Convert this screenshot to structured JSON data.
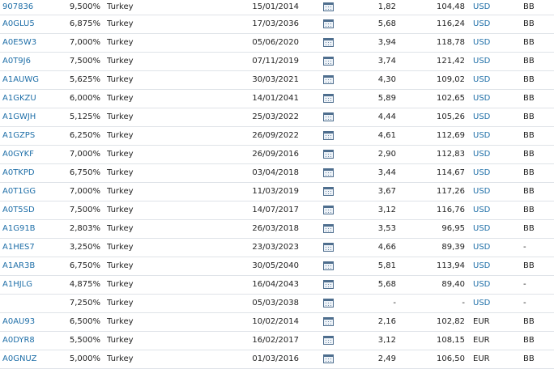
{
  "colors": {
    "link": "#1f6fa8",
    "row_border": "#dfe3e8",
    "text": "#222222"
  },
  "row_icon": "calendar-icon",
  "bonds": [
    {
      "wkn": "907836",
      "coupon": "9,500%",
      "issuer": "Turkey",
      "maturity": "15/01/2014",
      "duration": "1,82",
      "price": "104,48",
      "currency": "USD",
      "rating": "BB"
    },
    {
      "wkn": "A0GLU5",
      "coupon": "6,875%",
      "issuer": "Turkey",
      "maturity": "17/03/2036",
      "duration": "5,68",
      "price": "116,24",
      "currency": "USD",
      "rating": "BB"
    },
    {
      "wkn": "A0E5W3",
      "coupon": "7,000%",
      "issuer": "Turkey",
      "maturity": "05/06/2020",
      "duration": "3,94",
      "price": "118,78",
      "currency": "USD",
      "rating": "BB"
    },
    {
      "wkn": "A0T9J6",
      "coupon": "7,500%",
      "issuer": "Turkey",
      "maturity": "07/11/2019",
      "duration": "3,74",
      "price": "121,42",
      "currency": "USD",
      "rating": "BB"
    },
    {
      "wkn": "A1AUWG",
      "coupon": "5,625%",
      "issuer": "Turkey",
      "maturity": "30/03/2021",
      "duration": "4,30",
      "price": "109,02",
      "currency": "USD",
      "rating": "BB"
    },
    {
      "wkn": "A1GKZU",
      "coupon": "6,000%",
      "issuer": "Turkey",
      "maturity": "14/01/2041",
      "duration": "5,89",
      "price": "102,65",
      "currency": "USD",
      "rating": "BB"
    },
    {
      "wkn": "A1GWJH",
      "coupon": "5,125%",
      "issuer": "Turkey",
      "maturity": "25/03/2022",
      "duration": "4,44",
      "price": "105,26",
      "currency": "USD",
      "rating": "BB"
    },
    {
      "wkn": "A1GZPS",
      "coupon": "6,250%",
      "issuer": "Turkey",
      "maturity": "26/09/2022",
      "duration": "4,61",
      "price": "112,69",
      "currency": "USD",
      "rating": "BB"
    },
    {
      "wkn": "A0GYKF",
      "coupon": "7,000%",
      "issuer": "Turkey",
      "maturity": "26/09/2016",
      "duration": "2,90",
      "price": "112,83",
      "currency": "USD",
      "rating": "BB"
    },
    {
      "wkn": "A0TKPD",
      "coupon": "6,750%",
      "issuer": "Turkey",
      "maturity": "03/04/2018",
      "duration": "3,44",
      "price": "114,67",
      "currency": "USD",
      "rating": "BB"
    },
    {
      "wkn": "A0T1GG",
      "coupon": "7,000%",
      "issuer": "Turkey",
      "maturity": "11/03/2019",
      "duration": "3,67",
      "price": "117,26",
      "currency": "USD",
      "rating": "BB"
    },
    {
      "wkn": "A0T5SD",
      "coupon": "7,500%",
      "issuer": "Turkey",
      "maturity": "14/07/2017",
      "duration": "3,12",
      "price": "116,76",
      "currency": "USD",
      "rating": "BB"
    },
    {
      "wkn": "A1G91B",
      "coupon": "2,803%",
      "issuer": "Turkey",
      "maturity": "26/03/2018",
      "duration": "3,53",
      "price": "96,95",
      "currency": "USD",
      "rating": "BB"
    },
    {
      "wkn": "A1HES7",
      "coupon": "3,250%",
      "issuer": "Turkey",
      "maturity": "23/03/2023",
      "duration": "4,66",
      "price": "89,39",
      "currency": "USD",
      "rating": "-"
    },
    {
      "wkn": "A1AR3B",
      "coupon": "6,750%",
      "issuer": "Turkey",
      "maturity": "30/05/2040",
      "duration": "5,81",
      "price": "113,94",
      "currency": "USD",
      "rating": "BB"
    },
    {
      "wkn": "A1HJLG",
      "coupon": "4,875%",
      "issuer": "Turkey",
      "maturity": "16/04/2043",
      "duration": "5,68",
      "price": "89,40",
      "currency": "USD",
      "rating": "-"
    },
    {
      "wkn": "",
      "coupon": "7,250%",
      "issuer": "Turkey",
      "maturity": "05/03/2038",
      "duration": "-",
      "price": "-",
      "currency": "USD",
      "rating": "-"
    },
    {
      "wkn": "A0AU93",
      "coupon": "6,500%",
      "issuer": "Turkey",
      "maturity": "10/02/2014",
      "duration": "2,16",
      "price": "102,82",
      "currency": "EUR",
      "rating": "BB"
    },
    {
      "wkn": "A0DYR8",
      "coupon": "5,500%",
      "issuer": "Turkey",
      "maturity": "16/02/2017",
      "duration": "3,12",
      "price": "108,15",
      "currency": "EUR",
      "rating": "BB"
    },
    {
      "wkn": "A0GNUZ",
      "coupon": "5,000%",
      "issuer": "Turkey",
      "maturity": "01/03/2016",
      "duration": "2,49",
      "price": "106,50",
      "currency": "EUR",
      "rating": "BB"
    }
  ]
}
